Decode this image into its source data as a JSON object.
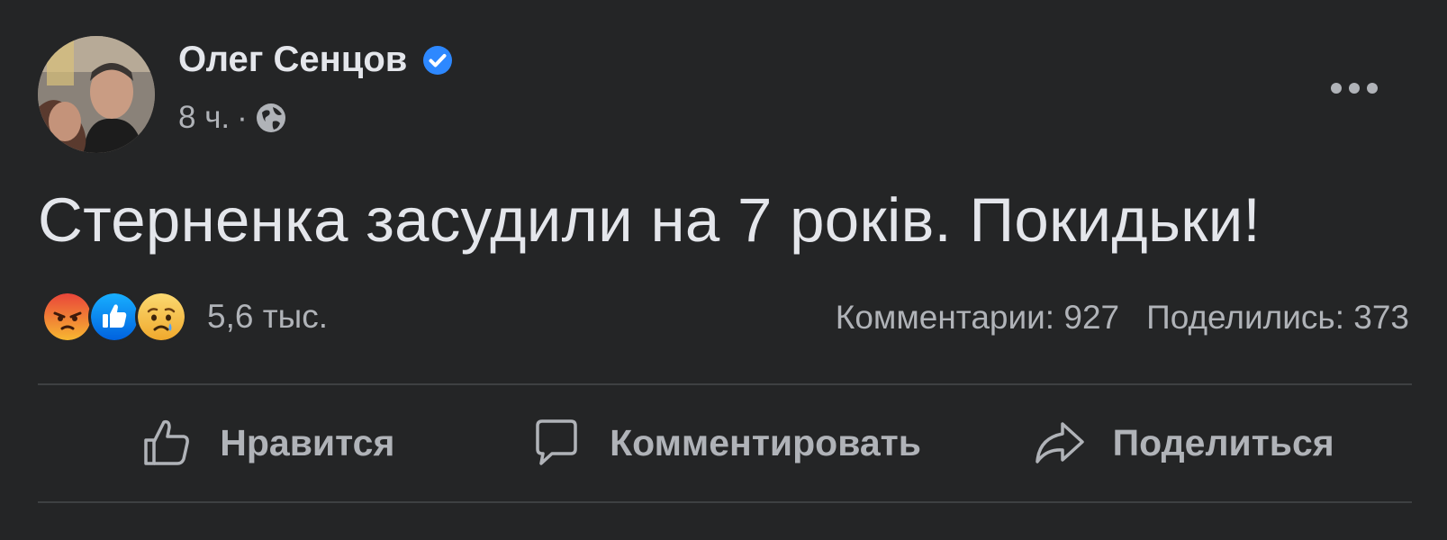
{
  "post": {
    "author": "Олег Сенцов",
    "time": "8 ч.",
    "separator": "·",
    "text": "Стерненка засудили на 7 років. Покидьки!",
    "reactions": {
      "icons": [
        "angry-reaction",
        "like-reaction",
        "sad-reaction"
      ],
      "count": "5,6 тыс."
    },
    "comments": "Комментарии: 927",
    "shares": "Поделились: 373"
  },
  "actions": {
    "like": "Нравится",
    "comment": "Комментировать",
    "share": "Поделиться"
  },
  "colors": {
    "background": "#242526",
    "primary_text": "#e4e6eb",
    "secondary_text": "#b0b3b8",
    "divider": "#3e4042",
    "verified_blue": "#2d88ff",
    "like_blue": "#1877f2",
    "angry_orange": "#f0582f",
    "sad_yellow": "#f7c747"
  }
}
